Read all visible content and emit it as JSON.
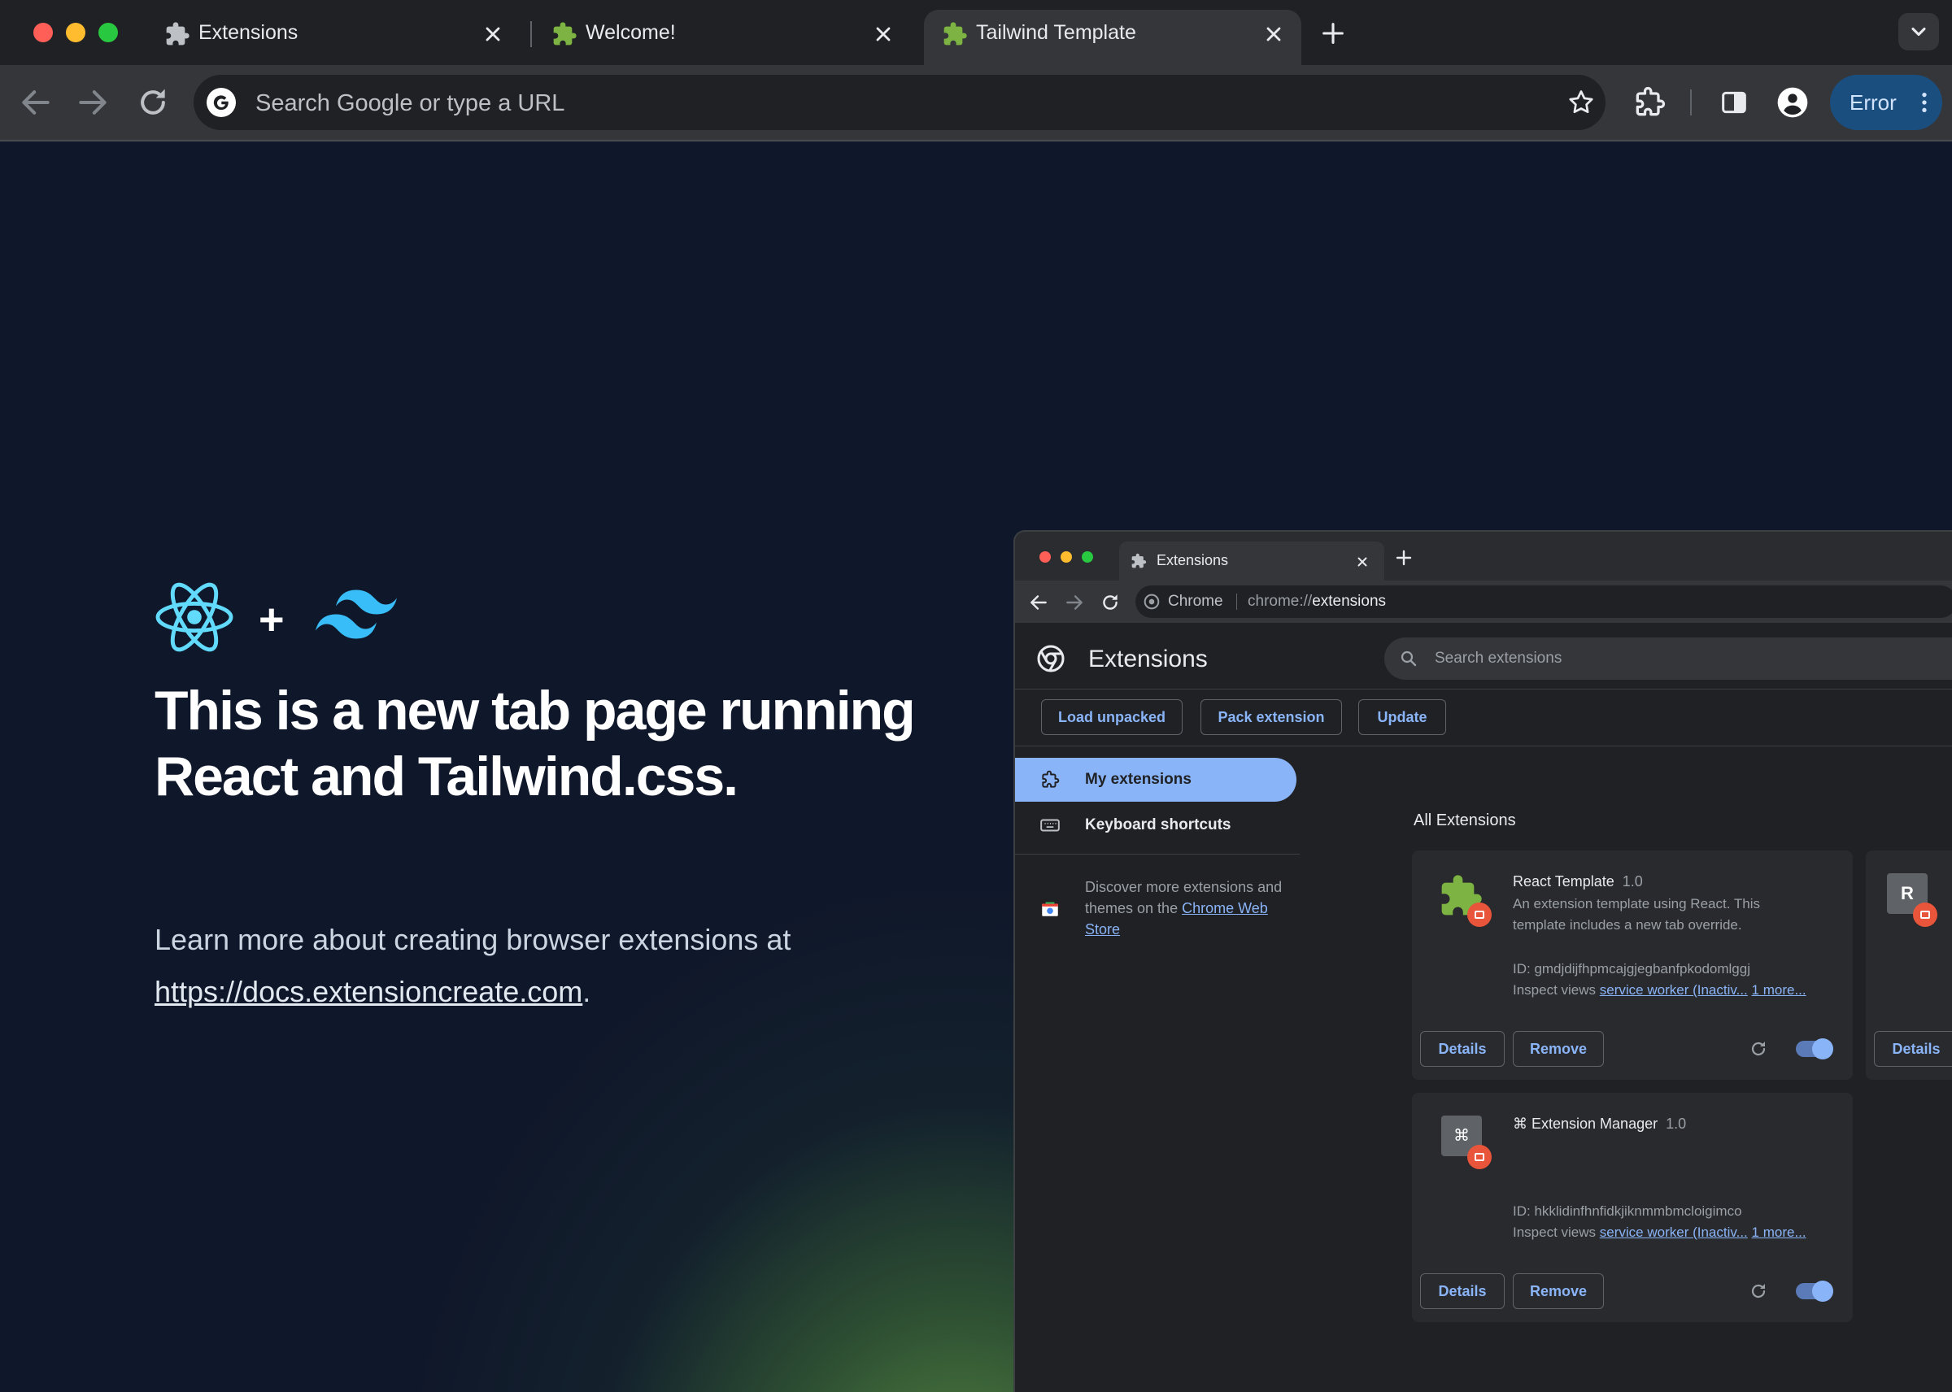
{
  "window": {
    "tabs": [
      {
        "title": "Extensions",
        "icon": "puzzle-icon",
        "active": false
      },
      {
        "title": "Welcome!",
        "icon": "green-puzzle-icon",
        "active": false
      },
      {
        "title": "Tailwind Template",
        "icon": "green-puzzle-icon",
        "active": true
      }
    ],
    "omnibox_placeholder": "Search Google or type a URL",
    "error_button_label": "Error"
  },
  "new_tab_page": {
    "logo_plus": "+",
    "heading": "This is a new tab page running React and Tailwind.css.",
    "learn_more_text": "Learn more about creating browser extensions at",
    "docs_link": "https://docs.extensioncreate.com",
    "period": "."
  },
  "nested_screenshot": {
    "tab_title": "Extensions",
    "omnibox_site": "Chrome",
    "omnibox_url_prefix": "chrome://",
    "omnibox_url_bold": "extensions",
    "page_title": "Extensions",
    "search_placeholder": "Search extensions",
    "actions": [
      "Load unpacked",
      "Pack extension",
      "Update"
    ],
    "sidebar": {
      "items": [
        {
          "label": "My extensions",
          "selected": true,
          "icon": "puzzle-outline-icon"
        },
        {
          "label": "Keyboard shortcuts",
          "selected": false,
          "icon": "keyboard-icon"
        }
      ],
      "discover_text": "Discover more extensions and themes on the",
      "store_link": "Chrome Web Store"
    },
    "section_title": "All Extensions",
    "extensions": [
      {
        "name": "React Template",
        "version": "1.0",
        "description_line1": "An extension template using React. This",
        "description_line2": "template includes a new tab override.",
        "id": "ID: gmdjdijfhpmcajgjegbanfpkodomlggj",
        "inspect_label": "Inspect views",
        "inspect_link": "service worker (Inactiv...",
        "more_link": "1 more...",
        "details": "Details",
        "remove": "Remove",
        "enabled": true
      },
      {
        "name": "⌘ Extension Manager",
        "version": "1.0",
        "icon_glyph": "⌘",
        "id": "ID: hkklidinfhnfidkjiknmmbmcloigimco",
        "inspect_label": "Inspect views",
        "inspect_link": "service worker (Inactiv...",
        "more_link": "1 more...",
        "details": "Details",
        "remove": "Remove",
        "enabled": true
      }
    ],
    "partial_card": {
      "icon_letter": "R",
      "details": "Details"
    }
  },
  "colors": {
    "page_bg": "#0f172a",
    "accent_blue": "#8ab4f8",
    "react_cyan": "#61dafb",
    "tailwind_sky": "#38bdf8",
    "error_button_bg": "#1a4e7e"
  }
}
